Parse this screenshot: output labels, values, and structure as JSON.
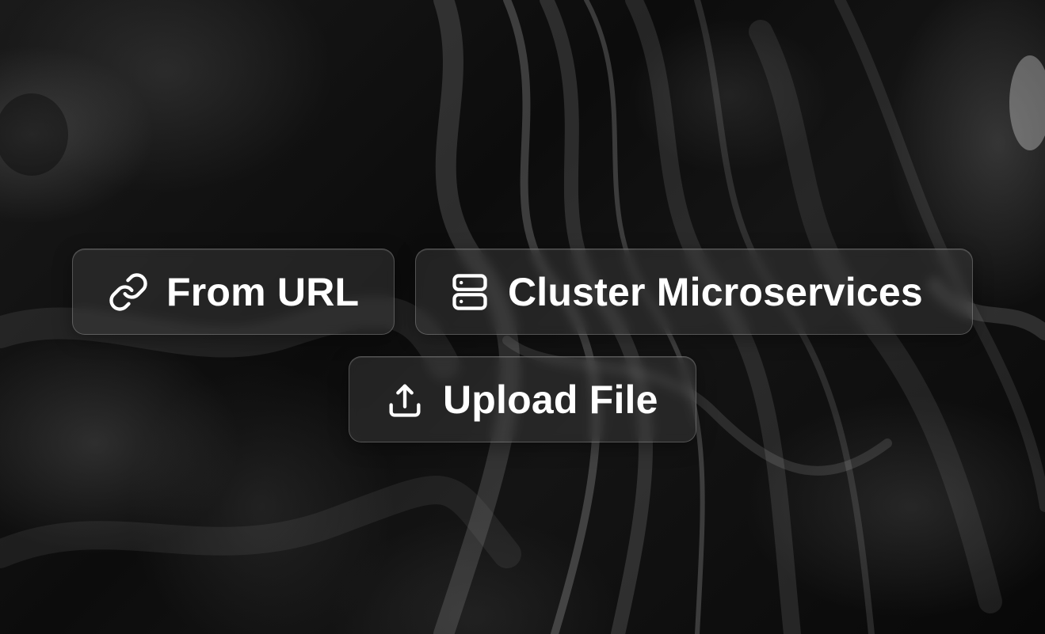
{
  "background": {
    "theme": "dark marble texture",
    "accent": "#ffffff"
  },
  "buttons": {
    "from_url": {
      "label": "From URL",
      "icon": "link-icon"
    },
    "cluster": {
      "label": "Cluster Microservices",
      "icon": "server-icon"
    },
    "upload": {
      "label": "Upload File",
      "icon": "upload-icon"
    }
  }
}
